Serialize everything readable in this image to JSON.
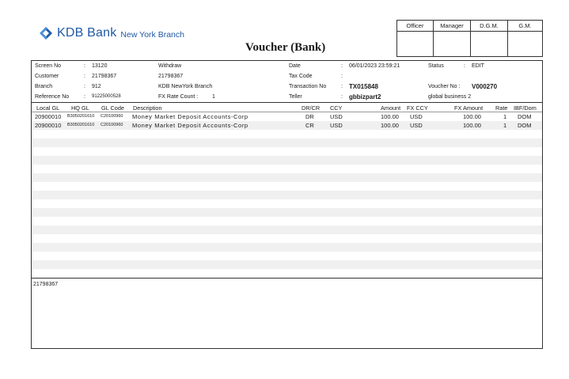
{
  "logo": {
    "bank": "KDB Bank",
    "branch": "New York Branch"
  },
  "title": "Voucher (Bank)",
  "approvals": [
    "Officer",
    "Manager",
    "D.G.M.",
    "G.M."
  ],
  "info": {
    "screen_no_label": "Screen No",
    "screen_no": "13120",
    "withdraw": "Withdraw",
    "customer_label": "Customer",
    "customer": "21798367",
    "customer_name": "21798367",
    "branch_label": "Branch",
    "branch": "912",
    "branch_name": "KDB NewYork Branch",
    "ref_label": "Reference No",
    "ref": "91225000528",
    "fx_label": "FX Rate Count :",
    "fx": "1",
    "date_label": "Date",
    "date": "06/01/2023  23:59:21",
    "status_label": "Status",
    "status": "EDIT",
    "tax_label": "Tax Code",
    "txn_label": "Transaction No",
    "txn": "TX015848",
    "voucher_label": "Voucher No :",
    "voucher": "V000270",
    "teller_label": "Teller",
    "teller": "gbbizpart2",
    "teller_desc": "global business 2",
    "colon": ":"
  },
  "columns": [
    "Local GL",
    "HQ GL",
    "GL Code",
    "Description",
    "DR/CR",
    "CCY",
    "Amount",
    "FX CCY",
    "FX Amount",
    "Rate",
    "IBF/Dom"
  ],
  "rows": [
    {
      "local_gl": "20900010",
      "hq_gl": "B3050201610",
      "gl_code": "C20100960",
      "description": "Money Market Deposit Accounts-Corp",
      "drcr": "DR",
      "ccy": "USD",
      "amount": "100.00",
      "fx_ccy": "USD",
      "fx_amount": "100.00",
      "rate": "1",
      "ibf": "DOM"
    },
    {
      "local_gl": "20900010",
      "hq_gl": "B3050201610",
      "gl_code": "C20100960",
      "description": "Money Market Deposit Accounts-Corp",
      "drcr": "CR",
      "ccy": "USD",
      "amount": "100.00",
      "fx_ccy": "USD",
      "fx_amount": "100.00",
      "rate": "1",
      "ibf": "DOM"
    }
  ],
  "notes": "21798367"
}
